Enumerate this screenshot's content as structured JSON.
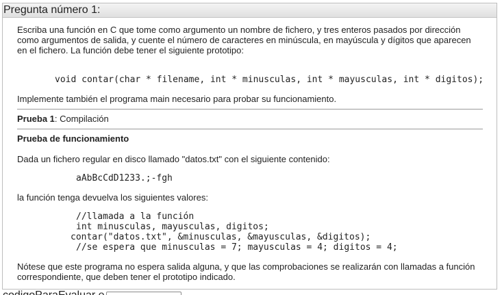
{
  "question": {
    "header": "Pregunta número 1:",
    "intro": "Escriba una función en C que tome como argumento un nombre de fichero, y tres enteros pasados por dirección como argumentos de salida, y cuente el número de caracteres en minúscula, en mayúscula y dígitos que aparecen en el fichero. La función debe tener el siguiente prototipo:",
    "prototype": "void contar(char * filename, int * minusculas, int * mayusculas, int * digitos);",
    "implement_note": "Implemente también el programa main necesario para probar su funcionamiento.",
    "test1_label": "Prueba 1",
    "test1_desc": ": Compilación",
    "functional_test_heading": "Prueba de funcionamiento",
    "file_intro": "Dada un fichero regular en disco llamado \"datos.txt\" con el siguiente contenido:",
    "file_content": "aAbBcCdD1233.;-fgh",
    "return_intro": "la función tenga devuelva los siguientes valores:",
    "call_code": {
      "line1": "//llamada a la función",
      "line2": "int minusculas, mayusculas, digitos;",
      "line3": "contar(\"datos.txt\", &minusculas, &mayusculas, &digitos);",
      "line4": "//se espera que minusculas = 7; mayusculas = 4; digitos = 4;"
    },
    "final_note": "Nótese que este programa no espera salida alguna, y que las comprobaciones se realizarán con llamadas a función correspondiente, que deben tener el prototipo indicado."
  },
  "answer_field": {
    "label": "codigoParaEvaluar e",
    "value": ""
  }
}
